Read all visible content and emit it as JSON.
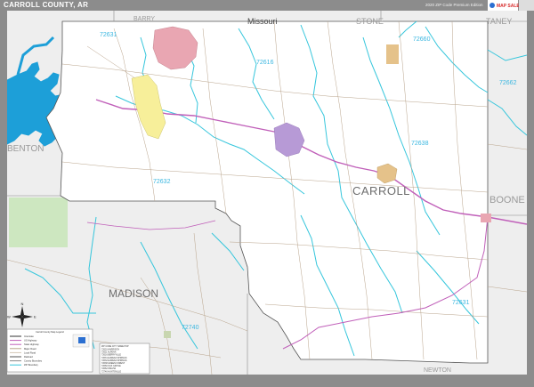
{
  "title": "CARROLL COUNTY, AR",
  "edition": "2020 ZIP Code Premium Edition",
  "publisher": "MAP SALES",
  "footer_text": "",
  "colors": {
    "frame": "#8c8c8c",
    "outside_county": "#eeeeee",
    "county_fill": "#ffffff",
    "water": "#36c6dc",
    "lake": "#1d9fd8",
    "highway": "#c05fb9",
    "roads": "#b9a48c",
    "zip_label": "#3bb7e0",
    "city_purple": "#b79ad6",
    "city_pink": "#e9a6b2",
    "city_yellow": "#f7ef9a",
    "city_orange": "#e5c28a",
    "forest": "#cde7c0"
  },
  "labels": {
    "state": "Missouri",
    "county_main": "CARROLL",
    "neighbors": {
      "barry": "BARRY",
      "stone": "STONE",
      "taney": "TANEY",
      "benton": "BENTON",
      "boone": "BOONE",
      "madison": "MADISON",
      "newton": "NEWTON"
    },
    "zips": {
      "z72631_top": "72631",
      "z72616": "72616",
      "z72660": "72660",
      "z72662": "72662",
      "z72638": "72638",
      "z72632": "72632",
      "z72631_low": "72631",
      "z72740": "72740"
    }
  },
  "legend": {
    "title": "Carroll County Map Legend",
    "items": [
      "Interstate",
      "US Highway",
      "State Highway",
      "Major Road",
      "Local Road",
      "Railroad",
      "County Boundary",
      "ZIP Boundary"
    ],
    "table_header": "ZIP CODE  CITY NAME  POP",
    "table_rows": [
      "72601 HARRISON",
      "72611 ALPENA",
      "72616 BERRYVILLE",
      "72631 EUREKA SPRINGS",
      "72632 EUREKA SPRINGS",
      "72638 GREEN FOREST",
      "72660 OAK GROVE",
      "72662 OMAHA",
      "72740 HUNTSVILLE"
    ]
  },
  "compass": {
    "n": "N",
    "s": "S",
    "e": "E",
    "w": "W"
  }
}
